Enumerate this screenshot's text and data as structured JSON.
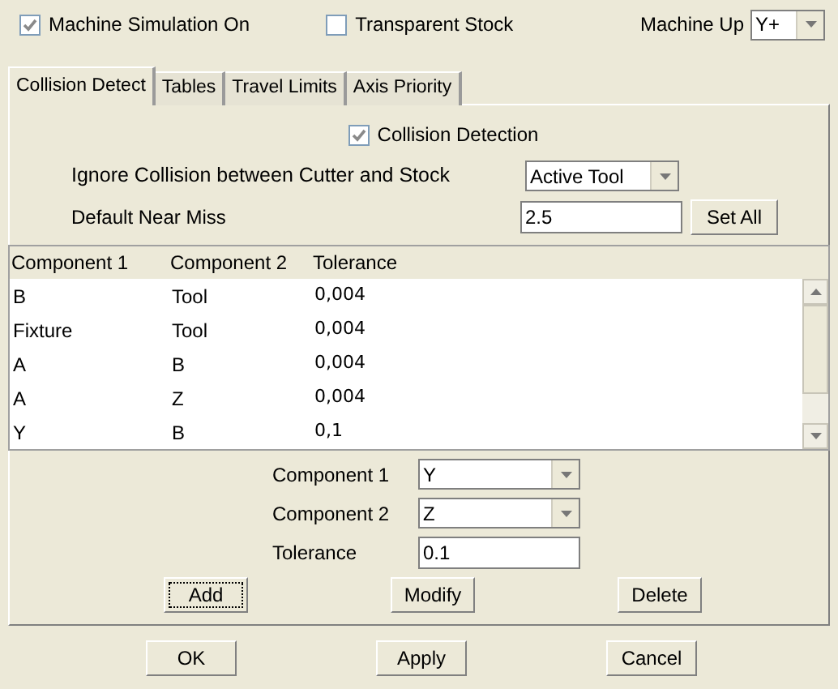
{
  "top": {
    "simulation": {
      "label": "Machine Simulation On",
      "checked": true
    },
    "transparent": {
      "label": "Transparent Stock",
      "checked": false
    },
    "machine_up": {
      "label": "Machine Up",
      "value": "Y+"
    }
  },
  "tabs": [
    {
      "label": "Collision Detect",
      "selected": true
    },
    {
      "label": "Tables",
      "selected": false
    },
    {
      "label": "Travel Limits",
      "selected": false
    },
    {
      "label": "Axis Priority",
      "selected": false
    }
  ],
  "collision_detection": {
    "label": "Collision Detection",
    "checked": true
  },
  "ignore": {
    "label": "Ignore Collision between Cutter and Stock",
    "value": "Active Tool"
  },
  "near_miss": {
    "label": "Default Near Miss",
    "value": "2.5",
    "button": "Set All"
  },
  "table": {
    "columns": [
      "Component 1",
      "Component 2",
      "Tolerance"
    ],
    "rows": [
      [
        "B",
        "Tool",
        "0,004"
      ],
      [
        "Fixture",
        "Tool",
        "0,004"
      ],
      [
        "A",
        "B",
        "0,004"
      ],
      [
        "A",
        "Z",
        "0,004"
      ],
      [
        "Y",
        "B",
        "0,1"
      ]
    ]
  },
  "editor": {
    "component1": {
      "label": "Component 1",
      "value": "Y"
    },
    "component2": {
      "label": "Component 2",
      "value": "Z"
    },
    "tolerance": {
      "label": "Tolerance",
      "value": "0.1"
    }
  },
  "actions": [
    "Add",
    "Modify",
    "Delete"
  ],
  "buttons": [
    "OK",
    "Apply",
    "Cancel"
  ]
}
